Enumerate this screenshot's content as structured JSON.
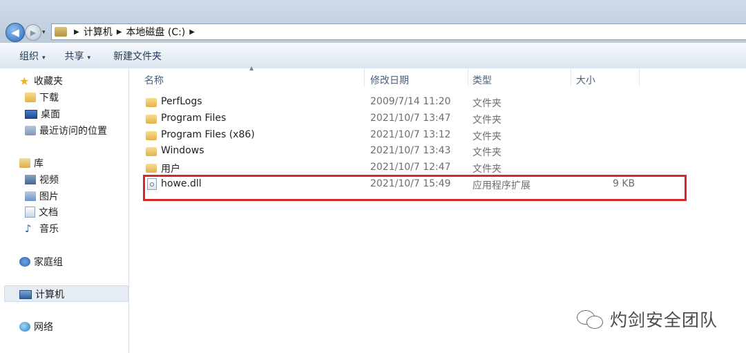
{
  "nav": {
    "back_glyph": "◀",
    "forward_glyph": "▶",
    "dropdown_glyph": "▾"
  },
  "address": {
    "sep": "▶",
    "crumbs": [
      "计算机",
      "本地磁盘 (C:)"
    ]
  },
  "toolbar": {
    "organize": "组织",
    "share": "共享",
    "new_folder": "新建文件夹",
    "arrow": "▾"
  },
  "sidebar": {
    "favorites": "收藏夹",
    "downloads": "下载",
    "desktop": "桌面",
    "recent": "最近访问的位置",
    "libraries": "库",
    "videos": "视频",
    "pictures": "图片",
    "documents": "文档",
    "music": "音乐",
    "homegroup": "家庭组",
    "computer": "计算机",
    "network": "网络"
  },
  "columns": {
    "name": "名称",
    "modified": "修改日期",
    "type": "类型",
    "size": "大小",
    "sort_glyph": "▲"
  },
  "files": [
    {
      "name": "PerfLogs",
      "modified": "2009/7/14 11:20",
      "type": "文件夹",
      "size": ""
    },
    {
      "name": "Program Files",
      "modified": "2021/10/7 13:47",
      "type": "文件夹",
      "size": ""
    },
    {
      "name": "Program Files (x86)",
      "modified": "2021/10/7 13:12",
      "type": "文件夹",
      "size": ""
    },
    {
      "name": "Windows",
      "modified": "2021/10/7 13:43",
      "type": "文件夹",
      "size": ""
    },
    {
      "name": "用户",
      "modified": "2021/10/7 12:47",
      "type": "文件夹",
      "size": ""
    },
    {
      "name": "howe.dll",
      "modified": "2021/10/7 15:49",
      "type": "应用程序扩展",
      "size": "9 KB"
    }
  ],
  "watermark": "灼剑安全团队",
  "colors": {
    "highlight_box": "#d9262b",
    "accent": "#2a69b7"
  }
}
